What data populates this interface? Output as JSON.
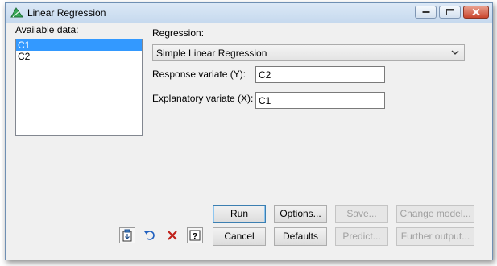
{
  "window": {
    "title": "Linear Regression",
    "icon": "chart-triangle-icon"
  },
  "available_data": {
    "label": "Available data:",
    "items": [
      "C1",
      "C2"
    ],
    "selected": "C1"
  },
  "regression": {
    "label": "Regression:",
    "selected": "Simple Linear Regression"
  },
  "response_variate": {
    "label": "Response variate (Y):",
    "value": "C2"
  },
  "explanatory_variate": {
    "label": "Explanatory variate (X):",
    "value": "C1"
  },
  "buttons": {
    "run": "Run",
    "options": "Options...",
    "save": "Save...",
    "change_model": "Change model...",
    "cancel": "Cancel",
    "defaults": "Defaults",
    "predict": "Predict...",
    "further_output": "Further output..."
  },
  "toolbar_icons": [
    "copy-to-clipboard-icon",
    "undo-icon",
    "clear-icon",
    "help-icon"
  ],
  "colors": {
    "selection": "#3399ff",
    "title_bar": "#c6d9ee",
    "close_button": "#c9452c"
  }
}
